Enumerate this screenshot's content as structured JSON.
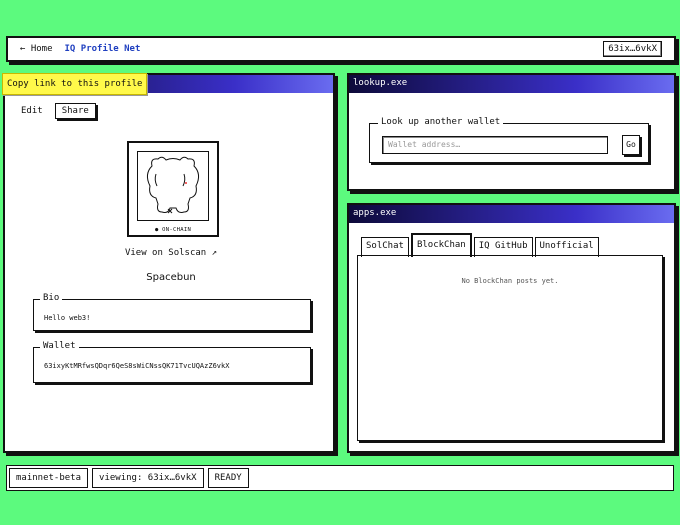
{
  "topbar": {
    "home_label": "← Home",
    "brand": "IQ Profile Net",
    "address_badge": "63ix…6vkX"
  },
  "profile": {
    "tooltip": "Copy link to this profile",
    "edit_label": "Edit",
    "share_label": "Share",
    "onchain_label": "● ON-CHAIN",
    "solscan_link": "View on Solscan ↗",
    "name": "Spacebun",
    "bio_legend": "Bio",
    "bio_value": "Hello web3!",
    "wallet_legend": "Wallet",
    "wallet_value": "63ixyKtMRfwsQDqr6QeS8sWiCNssQK71TvcUQAzZ6vkX"
  },
  "lookup": {
    "title": "lookup.exe",
    "legend": "Look up another wallet",
    "placeholder": "Wallet address…",
    "go_label": "Go"
  },
  "apps": {
    "title": "apps.exe",
    "tabs": [
      {
        "label": "SolChat",
        "active": false
      },
      {
        "label": "BlockChan",
        "active": true
      },
      {
        "label": "IQ GitHub",
        "active": false
      },
      {
        "label": "Unofficial",
        "active": false
      }
    ],
    "empty_message": "No BlockChan posts yet."
  },
  "statusbar": {
    "network": "mainnet-beta",
    "viewing": "viewing: 63ix…6vkX",
    "state": "READY"
  },
  "colors": {
    "background": "#5cfa7e",
    "titlebar_start": "#0d0a3a",
    "titlebar_end": "#6a6cf0",
    "tooltip": "#fff94a",
    "brand": "#2040c0"
  }
}
